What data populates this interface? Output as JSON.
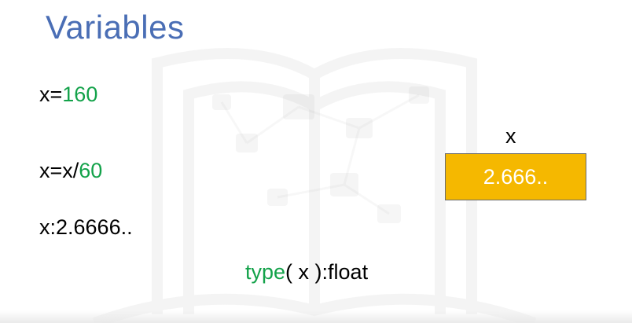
{
  "slide": {
    "title": "Variables",
    "lines": [
      {
        "prefix": "x=",
        "number": "160"
      },
      {
        "prefix": "x=x/",
        "number": "60"
      },
      {
        "text": "x:2.6666.."
      },
      {
        "func": "type",
        "rest": "( x ):float"
      }
    ],
    "variable": {
      "name": "x",
      "value": "2.666.."
    }
  },
  "colors": {
    "title": "#4a6eb5",
    "number": "#13a24a",
    "box_fill": "#f5b800",
    "box_text": "#ffffff"
  },
  "icons": {
    "watermark": "book-network-watermark-icon"
  }
}
